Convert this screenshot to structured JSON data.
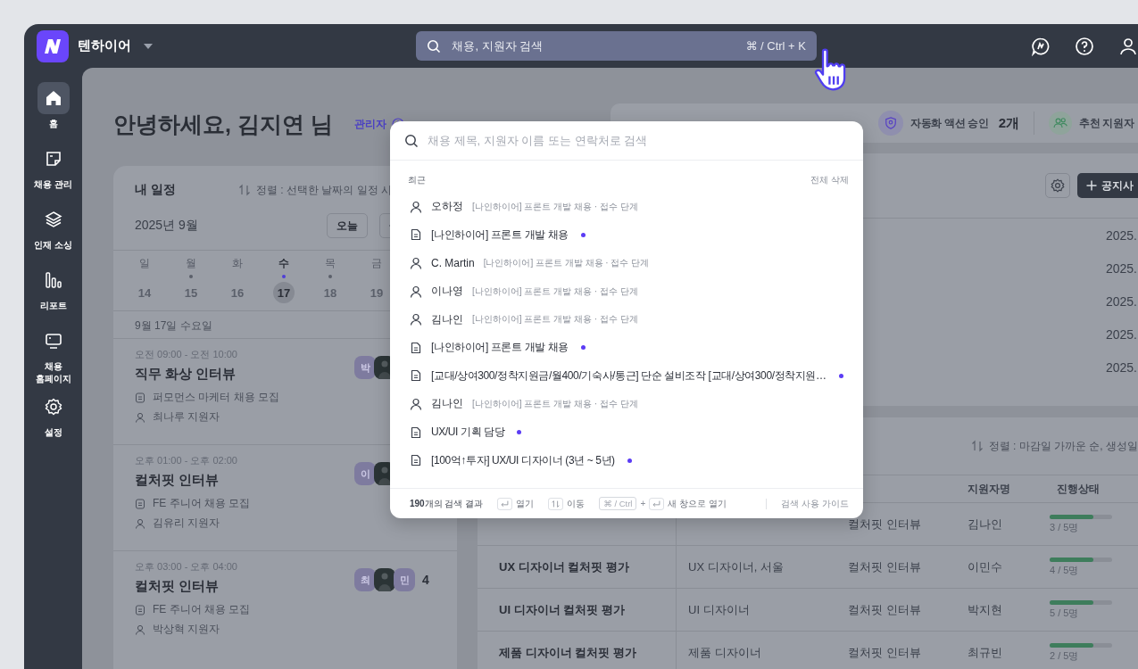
{
  "topbar": {
    "org_name": "텐하이어",
    "search": {
      "placeholder": "채용, 지원자 검색",
      "shortcut": "⌘ / Ctrl + K"
    }
  },
  "sidebar": {
    "items": [
      {
        "kind": "home",
        "label": "홈",
        "selected": true
      },
      {
        "kind": "document",
        "label": "채용 관리",
        "selected": false
      },
      {
        "kind": "layers",
        "label": "인재 소싱",
        "selected": false
      },
      {
        "kind": "chart",
        "label": "리포트",
        "selected": false
      },
      {
        "kind": "monitor",
        "label": "채용 홈페이지",
        "selected": false
      },
      {
        "kind": "gear",
        "label": "설정",
        "selected": false
      }
    ]
  },
  "greeting": {
    "title": "안녕하세요, 김지연 님",
    "role_badge": "관리자"
  },
  "stats": [
    {
      "kind": "shield",
      "label": "자동화 액션 승인",
      "value": "2개"
    },
    {
      "kind": "people",
      "label": "추천 지원자"
    }
  ],
  "schedule": {
    "title": "내 일정",
    "sort": "정렬 : 선택한 날짜의 일정 시",
    "month": "2025년 9월",
    "today_button": "오늘",
    "days": [
      {
        "weekday": "일",
        "date": "14",
        "dot": false,
        "selected": false
      },
      {
        "weekday": "월",
        "date": "15",
        "dot": true,
        "selected": false
      },
      {
        "weekday": "화",
        "date": "16",
        "dot": false,
        "selected": false
      },
      {
        "weekday": "수",
        "date": "17",
        "dot": true,
        "selected": true
      },
      {
        "weekday": "목",
        "date": "18",
        "dot": true,
        "selected": false
      },
      {
        "weekday": "금",
        "date": "19",
        "dot": false,
        "selected": false
      }
    ],
    "selected_date_label": "9월 17일 수요일",
    "events": [
      {
        "time": "오전 09:00 - 오전 10:00",
        "title": "직무 화상 인터뷰",
        "posting": "퍼모먼스 마케터 채용 모집",
        "applicant": "최나루 지원자",
        "avatars": [
          {
            "kind": "initial",
            "text": "박"
          },
          {
            "kind": "photo"
          }
        ]
      },
      {
        "time": "오후 01:00 - 오후 02:00",
        "title": "컬처핏 인터뷰",
        "posting": "FE 주니어 채용 모집",
        "applicant": "김유리 지원자",
        "avatars": [
          {
            "kind": "initial",
            "text": "이"
          },
          {
            "kind": "photo"
          }
        ]
      },
      {
        "time": "오후 03:00 - 오후 04:00",
        "title": "컬처핏 인터뷰",
        "posting": "FE 주니어 채용 모집",
        "applicant": "박상혁 지원자",
        "avatars": [
          {
            "kind": "initial",
            "text": "최"
          },
          {
            "kind": "photo"
          },
          {
            "kind": "initial",
            "text": "민"
          }
        ],
        "more": "4"
      }
    ]
  },
  "notices": {
    "add_button": "공지사",
    "dates": [
      "2025.",
      "2025.",
      "2025.",
      "2025.",
      "2025."
    ]
  },
  "evaluations": {
    "sort": "정렬 : 마감일 가까운 순, 생성일",
    "header": {
      "applicant": "지원자명",
      "status": "진행상태"
    },
    "rows": [
      {
        "stage": "컬처핏 인터뷰",
        "applicant": "김나인",
        "level": 0.7,
        "progress": "3 / 5명"
      },
      {
        "title": "UX 디자이너 컬처핏 평가",
        "position": "UX 디자이너, 서울",
        "stage": "컬처핏 인터뷰",
        "applicant": "이민수",
        "level": 0.7,
        "progress": "4 / 5명"
      },
      {
        "title": "UI 디자이너 컬처핏 평가",
        "position": "UI 디자이너",
        "stage": "컬처핏 인터뷰",
        "applicant": "박지현",
        "level": 0.7,
        "progress": "5 / 5명"
      },
      {
        "title": "제품 디자이너 컬처핏 평가",
        "position": "제품 디자이너",
        "stage": "컬처핏 인터뷰",
        "applicant": "최규빈",
        "level": 0.7,
        "progress": "2 / 5명"
      }
    ]
  },
  "search_popup": {
    "placeholder": "채용 제목, 지원자 이름 또는 연락처로 검색",
    "section": "최근",
    "clear_all": "전체 삭제",
    "items": [
      {
        "kind": "person",
        "name": "오하정",
        "meta": "[나인하이어] 프론트 개발 채용 · 접수 단계"
      },
      {
        "kind": "posting",
        "title": "[나인하이어] 프론트 개발 채용",
        "dot": true
      },
      {
        "kind": "person",
        "name": "C. Martin",
        "meta": "[나인하이어] 프론트 개발 채용 · 접수 단계"
      },
      {
        "kind": "person",
        "name": "이나영",
        "meta": "[나인하이어] 프론트 개발 채용 · 접수 단계"
      },
      {
        "kind": "person",
        "name": "김나인",
        "meta": "[나인하이어] 프론트 개발 채용 · 접수 단계"
      },
      {
        "kind": "posting",
        "title": "[나인하이어] 프론트 개발 채용",
        "dot": true
      },
      {
        "kind": "posting",
        "title": "[교대/상여300/정착지원금/월400/기숙사/통근] 단순 설비조작 [교대/상여300/정착지원…",
        "dot": true
      },
      {
        "kind": "person",
        "name": "김나인",
        "meta": "[나인하이어] 프론트 개발 채용 · 접수 단계"
      },
      {
        "kind": "posting",
        "title": "UX/UI 기획 담당",
        "dot": true
      },
      {
        "kind": "posting",
        "title": "[100억↑투자] UX/UI 디자이너 (3년 ~ 5년)",
        "dot": true
      }
    ],
    "footer": {
      "count": "**190**개의 검색 결과",
      "hints": [
        {
          "kind": "enter",
          "label": "열기"
        },
        {
          "kind": "updown",
          "label": "이동"
        },
        {
          "kind": "combo",
          "key": "⌘ / Ctrl",
          "plus": "+",
          "label": "새 창으로 열기"
        }
      ],
      "guide": "검색 사용 가이드"
    }
  }
}
